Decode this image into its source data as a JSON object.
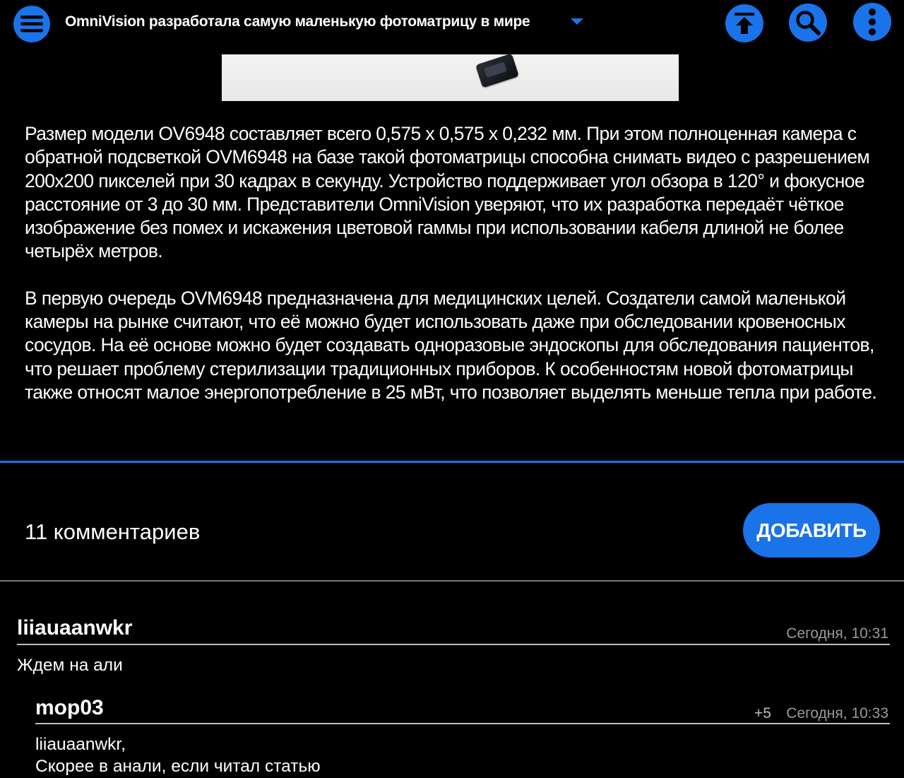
{
  "header": {
    "title": "OmniVision разработала самую маленькую фотоматрицу в мире",
    "menu_icon": "hamburger-menu-icon",
    "actions": [
      "upload-to-top-icon",
      "search-icon",
      "more-vertical-icon"
    ],
    "accent_color": "#1a73e8"
  },
  "article": {
    "paragraphs": [
      "Размер модели OV6948 составляет всего 0,575 x 0,575 x 0,232 мм. При этом полноценная камера с обратной подсветкой OVM6948 на базе такой фотоматрицы способна снимать видео с разрешением 200x200 пикселей при 30 кадрах в секунду. Устройство поддерживает угол обзора в 120° и фокусное расстояние от 3 до 30 мм. Представители OmniVision уверяют, что их разработка передаёт чёткое изображение без помех и искажения цветовой гаммы при использовании кабеля длиной не более четырёх метров.",
      "В первую очередь OVM6948 предназначена для медицинских целей. Создатели самой маленькой камеры на рынке считают, что её можно будет использовать даже при обследовании кровеносных сосудов. На её основе можно будет создавать одноразовые эндоскопы для обследования пациентов, что решает проблему стерилизации традиционных приборов. К особенностям новой фотоматрицы также относят малое энергопотребление в 25 мВт, что позволяет выделять меньше тепла при работе."
    ]
  },
  "comments_section": {
    "count_label": "11 комментариев",
    "add_label": "ДОБАВИТЬ"
  },
  "comments": [
    {
      "author": "liiauaanwkr",
      "time": "Сегодня, 10:31",
      "rating": "",
      "text_lines": [
        "Ждем на али"
      ]
    },
    {
      "author": "mop03",
      "time": "Сегодня, 10:33",
      "rating": "+5",
      "text_lines": [
        "liiauaanwkr,",
        "Скорее в анали, если читал статью"
      ]
    }
  ]
}
